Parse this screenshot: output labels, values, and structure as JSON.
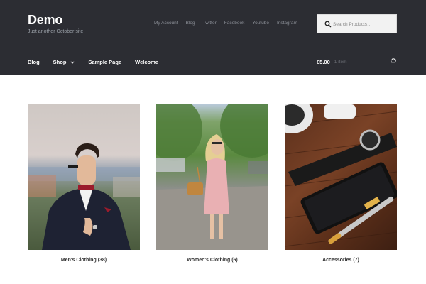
{
  "site": {
    "title": "Demo",
    "description": "Just another October site"
  },
  "secondary_nav": [
    "My Account",
    "Blog",
    "Twitter",
    "Facebook",
    "Youtube",
    "Instagram"
  ],
  "search": {
    "placeholder": "Search Products…"
  },
  "main_nav": [
    {
      "label": "Blog"
    },
    {
      "label": "Shop"
    },
    {
      "label": "Sample Page"
    },
    {
      "label": "Welcome"
    }
  ],
  "cart": {
    "total": "£5.00",
    "count": "1 item"
  },
  "products": [
    {
      "name": "Men's Clothing",
      "count": "(38)"
    },
    {
      "name": "Women's Clothing",
      "count": "(6)"
    },
    {
      "name": "Accessories",
      "count": "(7)"
    }
  ],
  "colors": {
    "header_bg": "#2c2d33",
    "header_text": "#ffffff",
    "muted_text": "#8b8f97"
  },
  "icons": {
    "search": "search-icon",
    "cart": "cart-icon",
    "chevron": "chevron-down-icon"
  }
}
